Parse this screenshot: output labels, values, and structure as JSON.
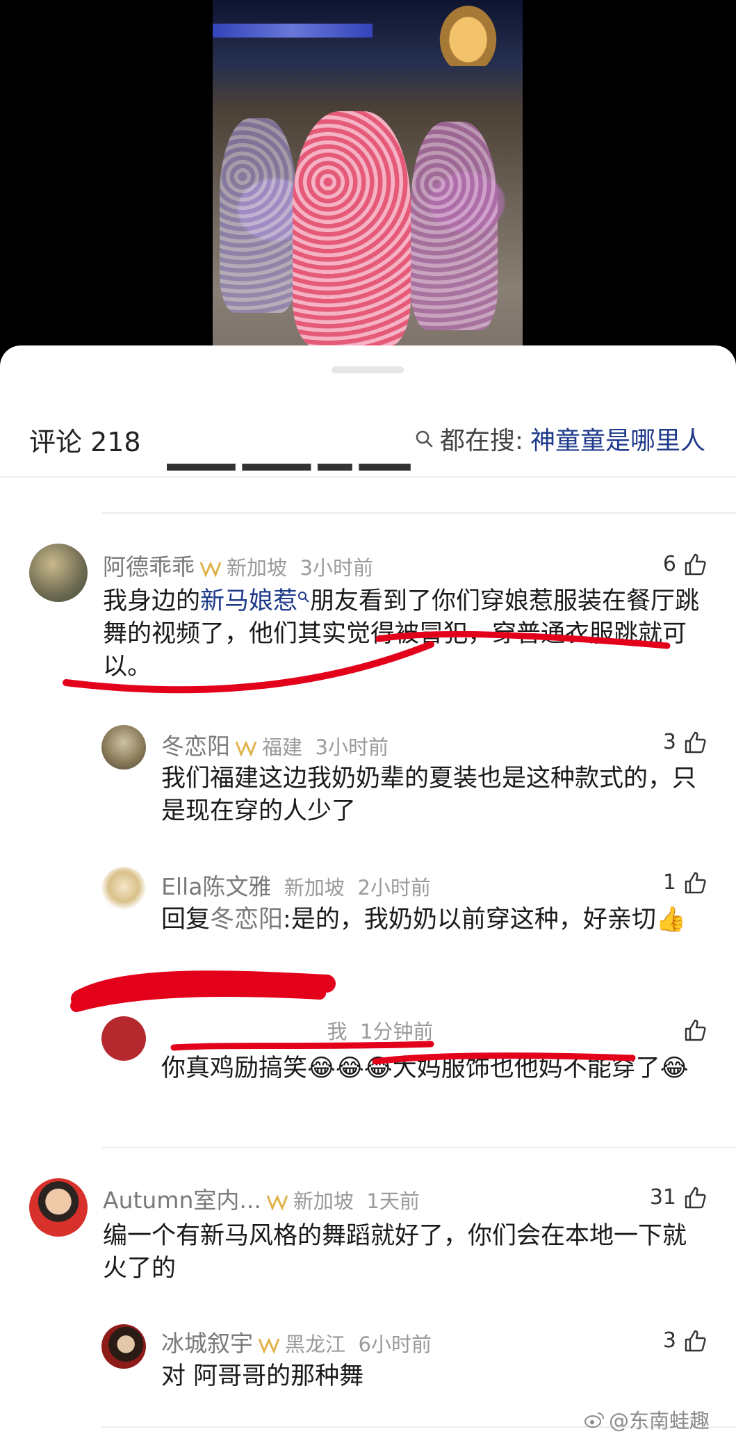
{
  "header": {
    "comments_label": "评论 218",
    "search_prefix": "都在搜:",
    "search_query": "神童童是哪里人"
  },
  "comments": [
    {
      "user": "阿德乖乖",
      "location": "新加坡",
      "time": "3小时前",
      "likes": "6",
      "text_pre": "我身边的",
      "text_link": "新马娘惹",
      "text_post": "朋友看到了你们穿娘惹服装在餐厅跳舞的视频了，他们其实觉得被冒犯，穿普通衣服跳就可以。",
      "replies": [
        {
          "user": "冬恋阳",
          "location": "福建",
          "time": "3小时前",
          "likes": "3",
          "text": "我们福建这边我奶奶辈的夏装也是这种款式的，只是现在穿的人少了"
        },
        {
          "user": "Ella陈文雅",
          "location": "新加坡",
          "time": "2小时前",
          "likes": "1",
          "reply_prefix": "回复",
          "reply_to": "冬恋阳",
          "text": ":是的，我奶奶以前穿这种，好亲切👍"
        },
        {
          "user": "",
          "location": "我",
          "time": "1分钟前",
          "likes": "",
          "text": "你真鸡励搞笑😂😂😂大妈服饰也他妈不能穿了😂"
        }
      ]
    },
    {
      "user": "Autumn室内...",
      "location": "新加坡",
      "time": "1天前",
      "likes": "31",
      "text": "编一个有新马风格的舞蹈就好了，你们会在本地一下就火了的",
      "replies": [
        {
          "user": "冰城叙宇",
          "location": "黑龙江",
          "time": "6小时前",
          "likes": "3",
          "text": "对 阿哥哥的那种舞"
        }
      ]
    }
  ],
  "watermark": "@东南蛙趣",
  "icons": {
    "search": "magnifier-icon",
    "like": "thumbs-up-outline-icon",
    "badge": "vip-badge-icon",
    "weibo": "weibo-logo-icon"
  },
  "colors": {
    "link": "#1f3a8a",
    "scribble": "#e3001b",
    "badge": "#e0b24a"
  }
}
